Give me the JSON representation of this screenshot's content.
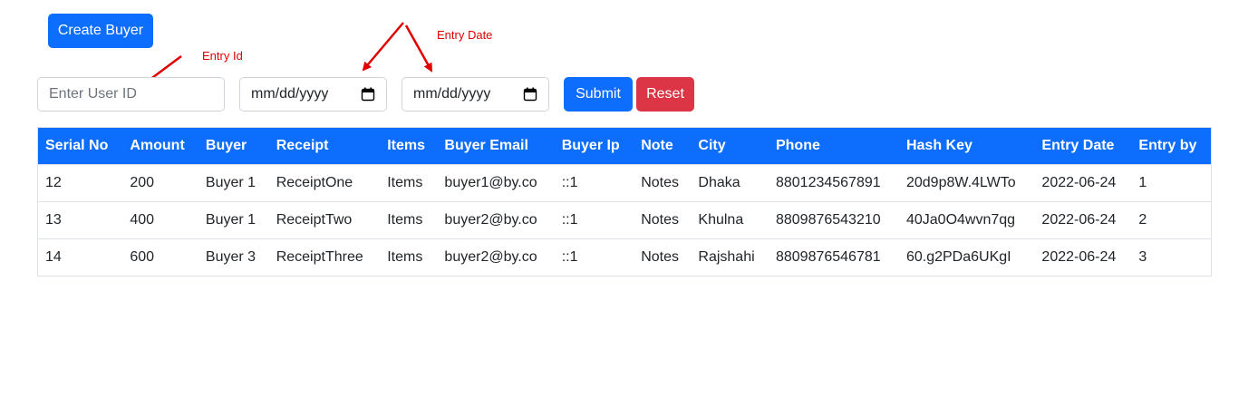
{
  "toolbar": {
    "create_label": "Create Buyer",
    "submit_label": "Submit",
    "reset_label": "Reset"
  },
  "filters": {
    "user_id_placeholder": "Enter User ID",
    "user_id_value": "",
    "date_from": "mm/dd/yyyy",
    "date_to": "mm/dd/yyyy"
  },
  "annotations": {
    "entry_id": "Entry Id",
    "entry_date": "Entry Date",
    "color": "#e00000"
  },
  "colors": {
    "primary": "#0d6efd",
    "danger": "#dc3545"
  },
  "table": {
    "columns": [
      "Serial No",
      "Amount",
      "Buyer",
      "Receipt",
      "Items",
      "Buyer Email",
      "Buyer Ip",
      "Note",
      "City",
      "Phone",
      "Hash Key",
      "Entry Date",
      "Entry by"
    ],
    "rows": [
      [
        "12",
        "200",
        "Buyer 1",
        "ReceiptOne",
        "Items",
        "buyer1@by.co",
        "::1",
        "Notes",
        "Dhaka",
        "8801234567891",
        "20d9p8W.4LWTo",
        "2022-06-24",
        "1"
      ],
      [
        "13",
        "400",
        "Buyer 1",
        "ReceiptTwo",
        "Items",
        "buyer2@by.co",
        "::1",
        "Notes",
        "Khulna",
        "8809876543210",
        "40Ja0O4wvn7qg",
        "2022-06-24",
        "2"
      ],
      [
        "14",
        "600",
        "Buyer 3",
        "ReceiptThree",
        "Items",
        "buyer2@by.co",
        "::1",
        "Notes",
        "Rajshahi",
        "8809876546781",
        "60.g2PDa6UKgI",
        "2022-06-24",
        "3"
      ]
    ]
  }
}
